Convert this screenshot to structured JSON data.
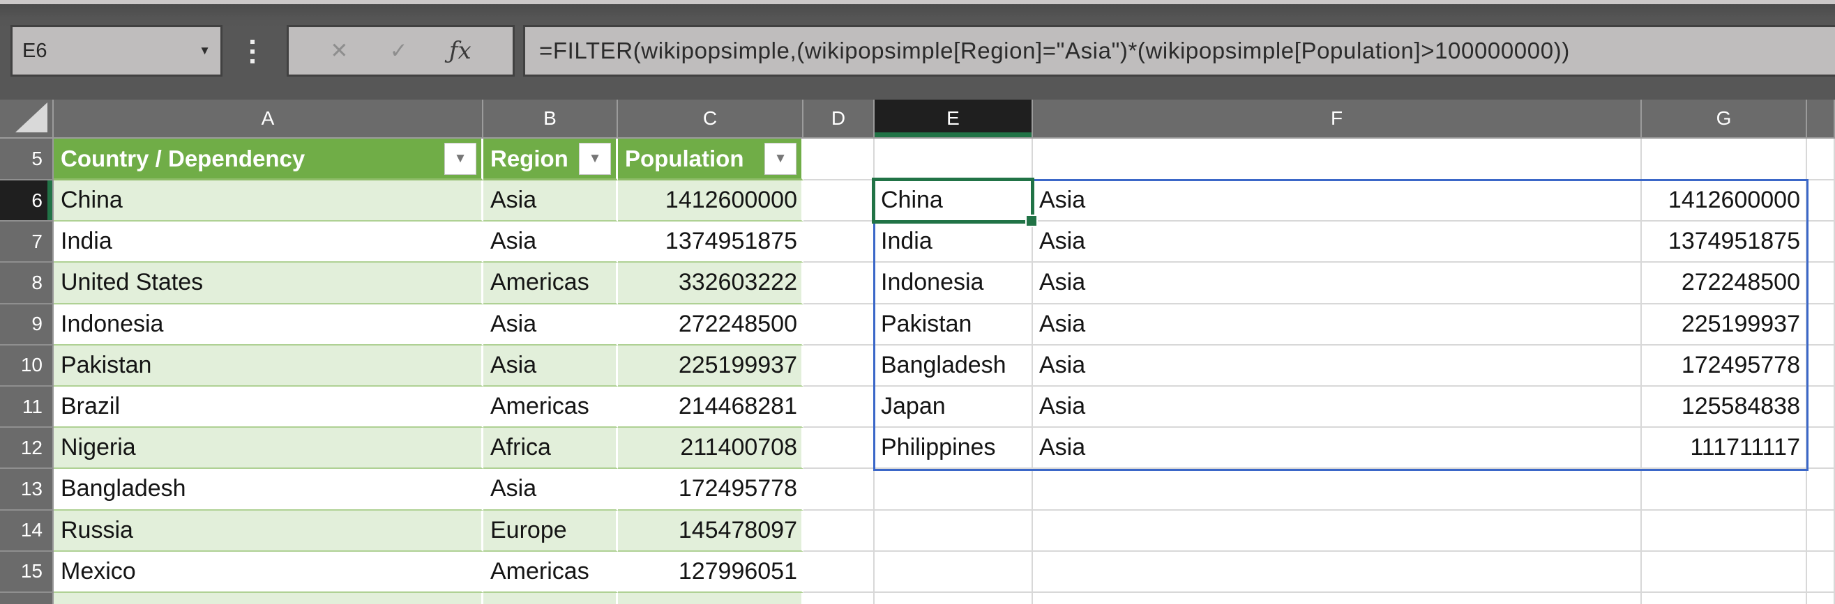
{
  "formula_bar": {
    "name_box": "E6",
    "dropdown_icon": "▼",
    "cancel_icon": "✕",
    "enter_icon": "✓",
    "fx_label": "ƒx",
    "formula": "=FILTER(wikipopsimple,(wikipopsimple[Region]=\"Asia\")*(wikipopsimple[Population]>100000000))"
  },
  "sheet": {
    "column_headers": [
      "A",
      "B",
      "C",
      "D",
      "E",
      "F",
      "G"
    ],
    "row_headers": [
      "5",
      "6",
      "7",
      "8",
      "9",
      "10",
      "11",
      "12",
      "13",
      "14",
      "15"
    ],
    "selected_cell": "E6",
    "selected_column": "E",
    "selected_row": "6"
  },
  "table": {
    "filter_icon": "▼",
    "headers": [
      "Country / Dependency",
      "Region",
      "Population"
    ],
    "rows": [
      {
        "country": "China",
        "region": "Asia",
        "population": "1412600000"
      },
      {
        "country": "India",
        "region": "Asia",
        "population": "1374951875"
      },
      {
        "country": "United States",
        "region": "Americas",
        "population": "332603222"
      },
      {
        "country": "Indonesia",
        "region": "Asia",
        "population": "272248500"
      },
      {
        "country": "Pakistan",
        "region": "Asia",
        "population": "225199937"
      },
      {
        "country": "Brazil",
        "region": "Americas",
        "population": "214468281"
      },
      {
        "country": "Nigeria",
        "region": "Africa",
        "population": "211400708"
      },
      {
        "country": "Bangladesh",
        "region": "Asia",
        "population": "172495778"
      },
      {
        "country": "Russia",
        "region": "Europe",
        "population": "145478097"
      },
      {
        "country": "Mexico",
        "region": "Americas",
        "population": "127996051"
      }
    ]
  },
  "spill": {
    "rows": [
      {
        "country": "China",
        "region": "Asia",
        "population": "1412600000"
      },
      {
        "country": "India",
        "region": "Asia",
        "population": "1374951875"
      },
      {
        "country": "Indonesia",
        "region": "Asia",
        "population": "272248500"
      },
      {
        "country": "Pakistan",
        "region": "Asia",
        "population": "225199937"
      },
      {
        "country": "Bangladesh",
        "region": "Asia",
        "population": "172495778"
      },
      {
        "country": "Japan",
        "region": "Asia",
        "population": "125584838"
      },
      {
        "country": "Philippines",
        "region": "Asia",
        "population": "111711117"
      }
    ]
  },
  "colors": {
    "selection_green": "#217346",
    "table_header_green": "#70ad47",
    "band_green": "#e2efda",
    "spill_blue": "#3b67c8",
    "chrome_gray": "#575757",
    "header_gray": "#6b6b6b"
  }
}
